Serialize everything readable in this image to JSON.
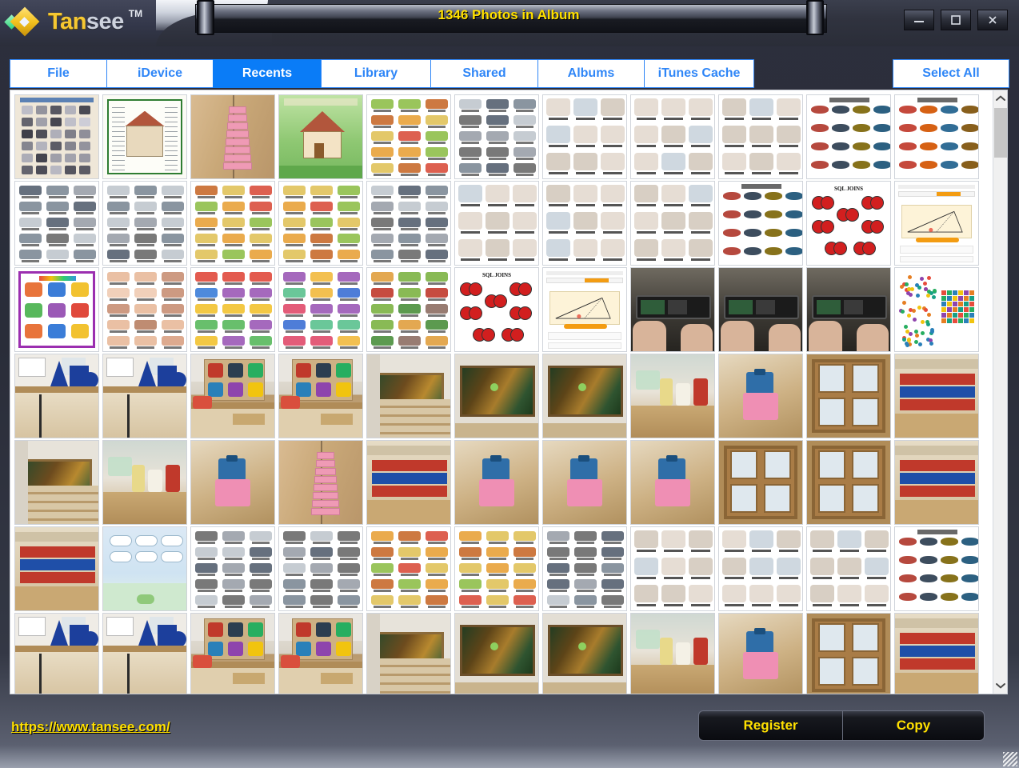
{
  "window": {
    "title": "1346 Photos in Album",
    "logo": {
      "word_a": "Tan",
      "word_b": "see",
      "tm": "TM"
    },
    "controls": {
      "minimize": "minimize-button",
      "maximize": "maximize-button",
      "close": "close-button"
    }
  },
  "tabs": [
    {
      "id": "file",
      "label": "File",
      "active": false
    },
    {
      "id": "idevice",
      "label": "iDevice",
      "active": false
    },
    {
      "id": "recents",
      "label": "Recents",
      "active": true
    },
    {
      "id": "library",
      "label": "Library",
      "active": false
    },
    {
      "id": "shared",
      "label": "Shared",
      "active": false
    },
    {
      "id": "albums",
      "label": "Albums",
      "active": false
    },
    {
      "id": "itunes_cache",
      "label": "iTunes Cache",
      "active": false
    }
  ],
  "select_all": {
    "label": "Select All"
  },
  "footer": {
    "url": "https://www.tansee.com/",
    "register_label": "Register",
    "copy_label": "Copy"
  },
  "colors": {
    "accent_blue": "#0a7cf7",
    "tab_border": "#2f86f7",
    "title_yellow": "#ffe000",
    "chrome_dark": "#2b2e3b",
    "panel_white": "#ffffff",
    "scrollbar_thumb": "#c6c6c6"
  },
  "photo_grid": {
    "columns": 11,
    "visible_rows": 7,
    "total_photos_text": "1346 Photos in Album",
    "items": [
      {
        "kind": "poster-appliances",
        "caption": "Household Devices and Appliances"
      },
      {
        "kind": "poster-house",
        "caption": "House cutaway diagram"
      },
      {
        "kind": "photo-pink-stack",
        "caption": "Pink tower blocks on wood"
      },
      {
        "kind": "poster-house-parts",
        "caption": "Parts of a House"
      },
      {
        "kind": "poster-food",
        "caption": "Food vocabulary chart"
      },
      {
        "kind": "poster-text",
        "caption": "Text vocabulary chart"
      },
      {
        "kind": "poster-routine",
        "caption": "Daily routine chart"
      },
      {
        "kind": "poster-routine2",
        "caption": "Household chores chart"
      },
      {
        "kind": "poster-routine3",
        "caption": "Daily activities chart"
      },
      {
        "kind": "poster-insects",
        "caption": "Insects chart"
      },
      {
        "kind": "poster-fish",
        "caption": "Fish chart"
      },
      {
        "kind": "poster-text",
        "caption": "Vocabulary chart"
      },
      {
        "kind": "poster-text",
        "caption": "Vocabulary chart"
      },
      {
        "kind": "poster-food",
        "caption": "Food chart"
      },
      {
        "kind": "poster-food",
        "caption": "Food chart"
      },
      {
        "kind": "poster-text",
        "caption": "Vocabulary chart"
      },
      {
        "kind": "poster-routine",
        "caption": "Daily routine chart"
      },
      {
        "kind": "poster-routine2",
        "caption": "Household chores chart"
      },
      {
        "kind": "poster-routine3",
        "caption": "Daily activities chart"
      },
      {
        "kind": "poster-insects",
        "caption": "Insects chart"
      },
      {
        "kind": "diagram-sql-joins",
        "caption": "SQL JOINS diagram"
      },
      {
        "kind": "doc-triangle",
        "caption": "Triangle geometry webpage"
      },
      {
        "kind": "poster-first-words",
        "caption": "First Words chart"
      },
      {
        "kind": "poster-body-parts",
        "caption": "Body Parts chart"
      },
      {
        "kind": "poster-toys",
        "caption": "Toys chart"
      },
      {
        "kind": "poster-clothes",
        "caption": "Clothes chart"
      },
      {
        "kind": "poster-nature",
        "caption": "Nature and animals chart"
      },
      {
        "kind": "diagram-sql-joins",
        "caption": "SQL JOINS diagram"
      },
      {
        "kind": "doc-triangle",
        "caption": "Triangle geometry webpage"
      },
      {
        "kind": "photo-repair",
        "caption": "Phone repair close-up"
      },
      {
        "kind": "photo-repair",
        "caption": "Phone repair close-up"
      },
      {
        "kind": "photo-repair",
        "caption": "Phone repair close-up"
      },
      {
        "kind": "diagram-color-cube",
        "caption": "Color cube diagram"
      },
      {
        "kind": "photo-blue-shapes",
        "caption": "Blue geometric solids on table"
      },
      {
        "kind": "photo-blue-shapes",
        "caption": "Blue geometric solids on table"
      },
      {
        "kind": "photo-puzzle-board",
        "caption": "Clothing puzzle board"
      },
      {
        "kind": "photo-puzzle-board",
        "caption": "Clothing puzzle board"
      },
      {
        "kind": "photo-framed-art",
        "caption": "Framed artwork and stairs"
      },
      {
        "kind": "photo-painting",
        "caption": "Landscape painting on wall"
      },
      {
        "kind": "photo-painting",
        "caption": "Landscape painting on wall"
      },
      {
        "kind": "photo-bottles",
        "caption": "Bottles on a shelf"
      },
      {
        "kind": "photo-cubes",
        "caption": "Colored cubes on floor"
      },
      {
        "kind": "photo-cabinet",
        "caption": "Glass-door wooden cabinet"
      },
      {
        "kind": "photo-red-blue",
        "caption": "Red and blue number rods"
      },
      {
        "kind": "photo-framed-art",
        "caption": "Framed artwork and stairs"
      },
      {
        "kind": "photo-bottles",
        "caption": "Bottles on a shelf"
      },
      {
        "kind": "photo-cubes",
        "caption": "Colored cubes on table"
      },
      {
        "kind": "photo-pink-stack",
        "caption": "Pink tower blocks"
      },
      {
        "kind": "photo-red-blue",
        "caption": "Red and blue number rods"
      },
      {
        "kind": "photo-cubes",
        "caption": "Colored cubes on floor"
      },
      {
        "kind": "photo-cubes",
        "caption": "Colored cubes on floor"
      },
      {
        "kind": "photo-cubes",
        "caption": "Colored cubes on floor"
      },
      {
        "kind": "photo-cabinet",
        "caption": "Glass-door wooden cabinet"
      },
      {
        "kind": "photo-cabinet",
        "caption": "Glass-door wooden cabinet"
      },
      {
        "kind": "photo-red-blue",
        "caption": "Red and blue number rods"
      },
      {
        "kind": "photo-red-blue",
        "caption": "Red and blue number rods"
      },
      {
        "kind": "app-screenshot",
        "caption": "Mobile app screenshot"
      },
      {
        "kind": "poster-text",
        "caption": "Vocabulary chart"
      },
      {
        "kind": "poster-text",
        "caption": "Vocabulary chart"
      },
      {
        "kind": "poster-food",
        "caption": "Food chart"
      },
      {
        "kind": "poster-food",
        "caption": "Food chart"
      },
      {
        "kind": "poster-text",
        "caption": "Vocabulary chart"
      },
      {
        "kind": "poster-routine",
        "caption": "Daily routine chart"
      },
      {
        "kind": "poster-routine2",
        "caption": "Household chores chart"
      },
      {
        "kind": "poster-routine3",
        "caption": "Daily activities chart"
      },
      {
        "kind": "poster-insects",
        "caption": "Insects chart"
      },
      {
        "kind": "photo-blue-shapes",
        "caption": "Blue geometric solids on table"
      },
      {
        "kind": "photo-blue-shapes",
        "caption": "Blue geometric solids on table"
      },
      {
        "kind": "photo-puzzle-board",
        "caption": "Clothing puzzle board"
      },
      {
        "kind": "photo-puzzle-board",
        "caption": "Clothing puzzle board"
      },
      {
        "kind": "photo-framed-art",
        "caption": "Framed artwork and stairs"
      },
      {
        "kind": "photo-painting",
        "caption": "Landscape painting on wall"
      },
      {
        "kind": "photo-painting",
        "caption": "Landscape painting on wall"
      },
      {
        "kind": "photo-bottles",
        "caption": "Bottles on a shelf"
      },
      {
        "kind": "photo-cubes",
        "caption": "Colored cubes on floor"
      },
      {
        "kind": "photo-cabinet",
        "caption": "Glass-door wooden cabinet"
      },
      {
        "kind": "photo-red-blue",
        "caption": "Red and blue number rods"
      }
    ]
  },
  "scrollbar": {
    "up_arrow": "chevron-up-icon",
    "down_arrow": "chevron-down-icon",
    "position_percent": 2
  }
}
